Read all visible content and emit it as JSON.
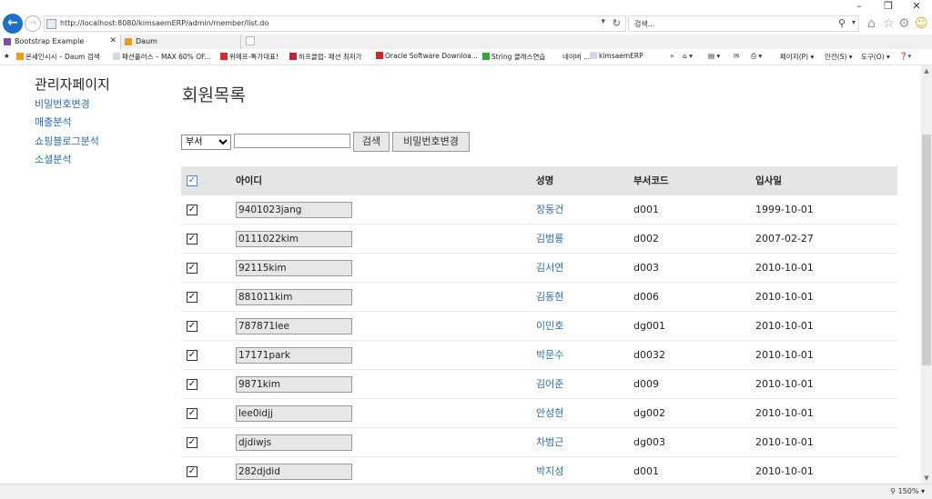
{
  "browser": {
    "window_controls": [
      "–",
      "❐",
      "✕"
    ],
    "url": "http://localhost:8080/kimsaemERP/admin/member/list.do",
    "search_placeholder": "검색...",
    "tabs": [
      {
        "label": "Bootstrap Example",
        "active": true
      },
      {
        "label": "Daum",
        "active": false
      }
    ],
    "favorites": [
      "온세인시시 – Daum 검색",
      "패션플러스 – MAX 60% OF...",
      "위메프-특가대표!",
      "하프클럽- 패션 최저가",
      "Oracle Software Downloa...",
      "String 클래스연습",
      "네이버 ...",
      "kimsaemERP"
    ],
    "toolbar_right": [
      "페이지(P)",
      "안전(S)",
      "도구(O)"
    ],
    "zoom": "150%"
  },
  "sidebar": {
    "title": "관리자페이지",
    "links": [
      "비밀번호변경",
      "매출분석",
      "쇼핑블로그분석",
      "소셜분석"
    ]
  },
  "page": {
    "title": "회원목록",
    "filter_select": "부서",
    "filter_input": "",
    "search_button": "검색",
    "password_button": "비밀번호변경"
  },
  "table": {
    "headers": {
      "id": "아이디",
      "name": "성명",
      "dept": "부서코드",
      "hire": "입사일"
    },
    "rows": [
      {
        "id": "9401023jang",
        "name": "장동건",
        "dept": "d001",
        "hire": "1999-10-01"
      },
      {
        "id": "0111022kim",
        "name": "김범룡",
        "dept": "d002",
        "hire": "2007-02-27"
      },
      {
        "id": "92115kim",
        "name": "김서연",
        "dept": "d003",
        "hire": "2010-10-01"
      },
      {
        "id": "881011kim",
        "name": "김동현",
        "dept": "d006",
        "hire": "2010-10-01"
      },
      {
        "id": "787871lee",
        "name": "이민호",
        "dept": "dg001",
        "hire": "2010-10-01"
      },
      {
        "id": "17171park",
        "name": "박문수",
        "dept": "d0032",
        "hire": "2010-10-01"
      },
      {
        "id": "9871kim",
        "name": "김어준",
        "dept": "d009",
        "hire": "2010-10-01"
      },
      {
        "id": "lee0idjj",
        "name": "안성현",
        "dept": "dg002",
        "hire": "2010-10-01"
      },
      {
        "id": "djdiwjs",
        "name": "차범근",
        "dept": "dg003",
        "hire": "2010-10-01"
      },
      {
        "id": "282djdid",
        "name": "박지성",
        "dept": "d001",
        "hire": "2010-10-01"
      }
    ]
  }
}
